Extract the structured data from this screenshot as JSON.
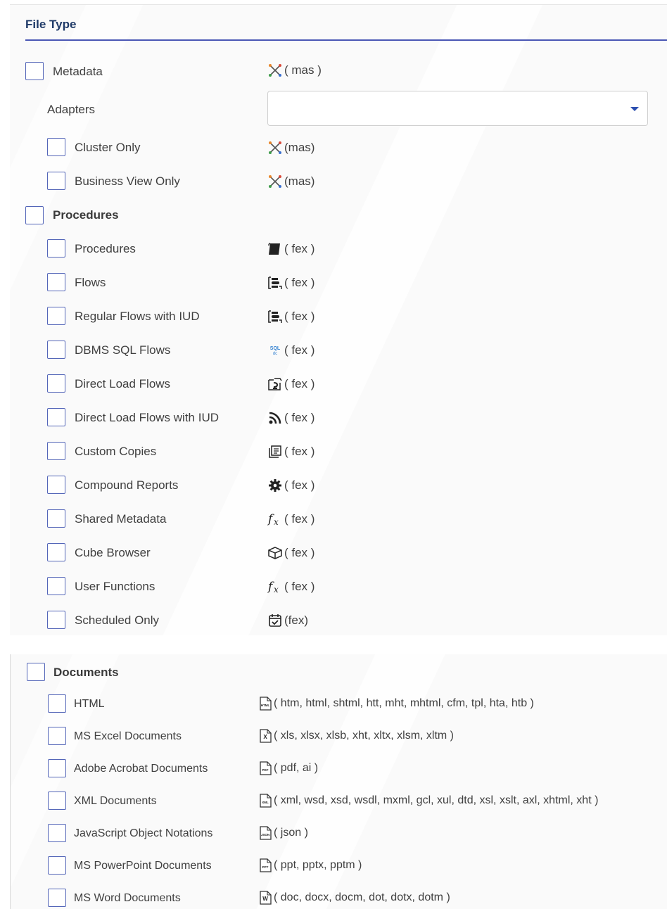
{
  "file_type_section": {
    "title": "File Type",
    "metadata": {
      "label": "Metadata",
      "ext": "( mas )",
      "icon": "metadata-cross-icon"
    },
    "adapters": {
      "label": "Adapters",
      "value": ""
    },
    "metadata_items": [
      {
        "label": "Cluster Only",
        "ext": "(mas)",
        "icon": "metadata-cross-icon"
      },
      {
        "label": "Business View Only",
        "ext": "(mas)",
        "icon": "metadata-cross-icon"
      }
    ],
    "procedures_group": {
      "label": "Procedures"
    },
    "procedure_items": [
      {
        "label": "Procedures",
        "ext": "( fex )",
        "icon": "procedure-scroll-icon"
      },
      {
        "label": "Flows",
        "ext": "( fex )",
        "icon": "flow-icon"
      },
      {
        "label": "Regular Flows with IUD",
        "ext": "( fex )",
        "icon": "flow-icon"
      },
      {
        "label": "DBMS SQL Flows",
        "ext": "( fex )",
        "icon": "sql-icon"
      },
      {
        "label": "Direct Load Flows",
        "ext": "( fex )",
        "icon": "direct-load-icon"
      },
      {
        "label": "Direct Load Flows with IUD",
        "ext": "( fex )",
        "icon": "rss-feed-icon"
      },
      {
        "label": "Custom Copies",
        "ext": "( fex )",
        "icon": "copy-icon"
      },
      {
        "label": "Compound Reports",
        "ext": "( fex )",
        "icon": "gear-icon"
      },
      {
        "label": "Shared Metadata",
        "ext": "( fex )",
        "icon": "function-fx-icon"
      },
      {
        "label": "Cube Browser",
        "ext": "( fex )",
        "icon": "cube-icon"
      },
      {
        "label": "User Functions",
        "ext": "( fex )",
        "icon": "function-fx-icon"
      },
      {
        "label": "Scheduled Only",
        "ext": "(fex)",
        "icon": "calendar-check-icon"
      }
    ]
  },
  "documents_section": {
    "group": {
      "label": "Documents"
    },
    "items": [
      {
        "label": "HTML",
        "ext": "( htm, html, shtml, htt, mht, mhtml, cfm, tpl, hta, htb )",
        "icon": "html-file-icon",
        "badge": "HTML"
      },
      {
        "label": "MS Excel Documents",
        "ext": "( xls, xlsx, xlsb, xht, xltx, xlsm, xltm )",
        "icon": "excel-file-icon",
        "badge": "X"
      },
      {
        "label": "Adobe Acrobat Documents",
        "ext": "( pdf, ai )",
        "icon": "pdf-file-icon",
        "badge": "PDF"
      },
      {
        "label": "XML Documents",
        "ext": "( xml, wsd, xsd, wsdl, mxml, gcl, xul, dtd, xsl, xslt, axl, xhtml, xht )",
        "icon": "xml-file-icon",
        "badge": "XML"
      },
      {
        "label": "JavaScript Object Notations",
        "ext": "( json )",
        "icon": "json-file-icon",
        "badge": "JSON"
      },
      {
        "label": "MS PowerPoint Documents",
        "ext": "( ppt, pptx, pptm )",
        "icon": "powerpoint-file-icon",
        "badge": "PPT"
      },
      {
        "label": "MS Word Documents",
        "ext": "( doc, docx, docm, dot, dotx, dotm )",
        "icon": "word-file-icon",
        "badge": "W"
      }
    ]
  },
  "colors": {
    "accent": "#4a57b4",
    "checkbox_border": "#5466b8",
    "header_text": "#1f3a68"
  }
}
